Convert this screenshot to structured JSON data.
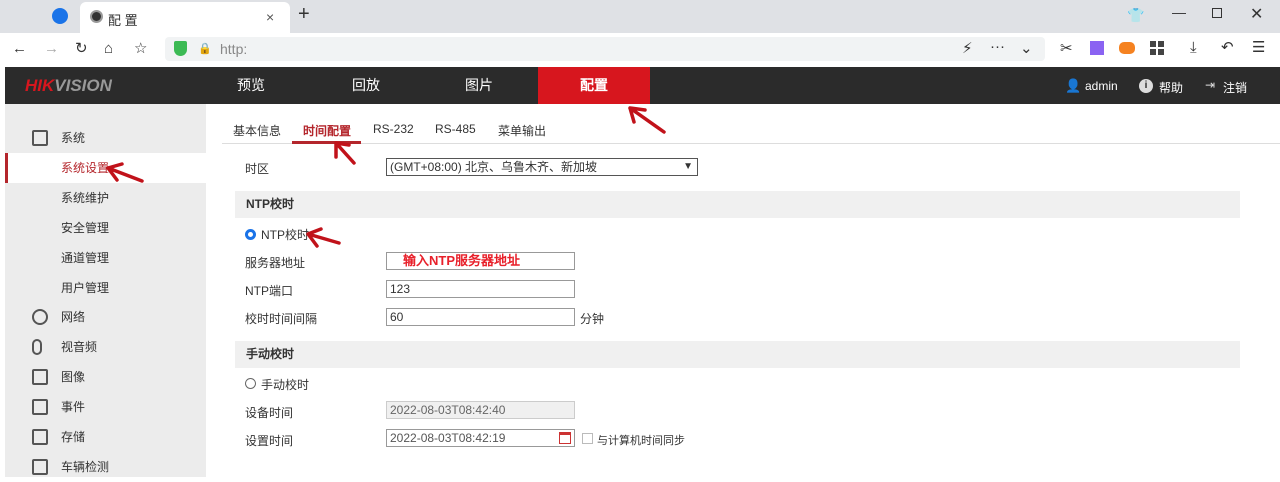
{
  "browser": {
    "tab_title": "配 置",
    "url": "http:",
    "new_tab": "+"
  },
  "header": {
    "logo_red": "HIK",
    "logo_rest": "VISION",
    "nav": [
      "预览",
      "回放",
      "图片",
      "配置"
    ],
    "user": "admin",
    "help": "帮助",
    "logout": "注销",
    "accent": "#d7161e"
  },
  "sidebar": {
    "items": [
      "系统",
      "系统设置",
      "系统维护",
      "安全管理",
      "通道管理",
      "用户管理",
      "网络",
      "视音频",
      "图像",
      "事件",
      "存储",
      "车辆检测"
    ]
  },
  "tabs": [
    "基本信息",
    "时间配置",
    "RS-232",
    "RS-485",
    "菜单输出"
  ],
  "form": {
    "timezone_label": "时区",
    "timezone_value": "(GMT+08:00) 北京、乌鲁木齐、新加坡",
    "ntp_section": "NTP校时",
    "ntp_radio": "NTP校时",
    "server_label": "服务器地址",
    "server_annotation": "输入NTP服务器地址",
    "port_label": "NTP端口",
    "port_value": "123",
    "interval_label": "校时时间间隔",
    "interval_value": "60",
    "interval_unit": "分钟",
    "manual_section": "手动校时",
    "manual_radio": "手动校时",
    "device_time_label": "设备时间",
    "device_time_value": "2022-08-03T08:42:40",
    "set_time_label": "设置时间",
    "set_time_value": "2022-08-03T08:42:19",
    "sync_label": "与计算机时间同步"
  }
}
